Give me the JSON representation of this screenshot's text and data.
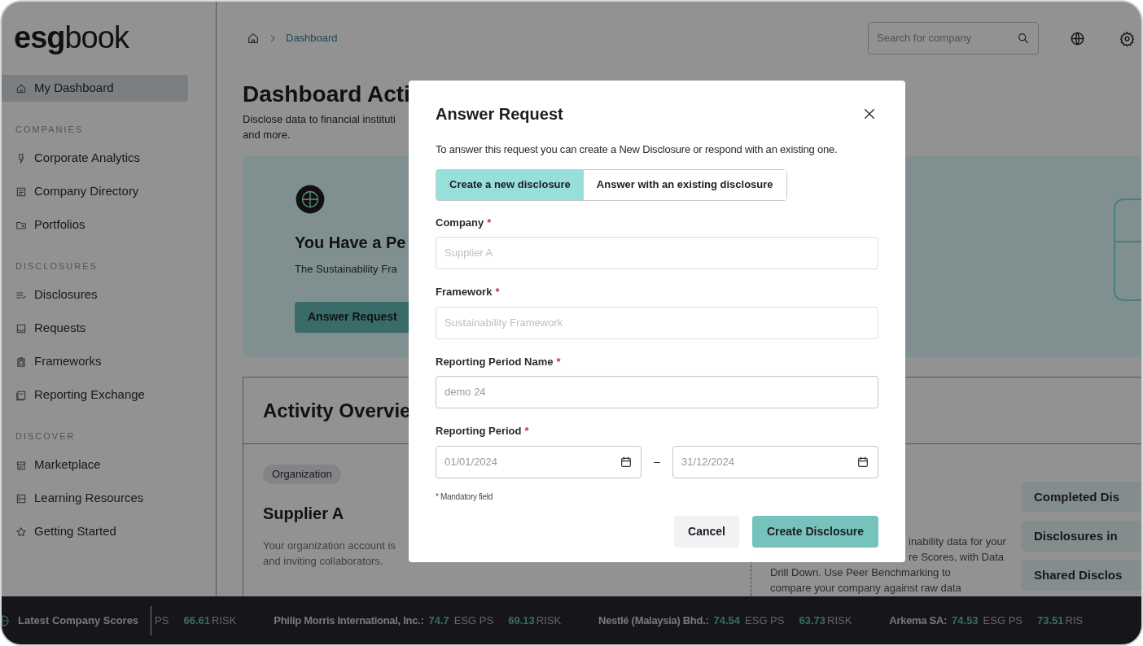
{
  "logo": {
    "bold": "esg",
    "light": "book"
  },
  "sidebar": {
    "sections": [
      {
        "items": [
          {
            "label": "My Dashboard",
            "selected": true
          }
        ]
      },
      {
        "heading": "COMPANIES",
        "items": [
          {
            "label": "Corporate Analytics",
            "selected": false
          },
          {
            "label": "Company Directory",
            "selected": false
          },
          {
            "label": "Portfolios",
            "selected": false
          }
        ]
      },
      {
        "heading": "DISCLOSURES",
        "items": [
          {
            "label": "Disclosures",
            "selected": false
          },
          {
            "label": "Requests",
            "selected": false
          },
          {
            "label": "Frameworks",
            "selected": false
          },
          {
            "label": "Reporting Exchange",
            "selected": false
          }
        ]
      },
      {
        "heading": "DISCOVER",
        "items": [
          {
            "label": "Marketplace",
            "selected": false
          },
          {
            "label": "Learning Resources",
            "selected": false
          },
          {
            "label": "Getting Started",
            "selected": false
          }
        ]
      }
    ]
  },
  "breadcrumb": [
    "Dashboard"
  ],
  "search": {
    "placeholder": "Search for company"
  },
  "page": {
    "title": "Dashboard Acti",
    "description": [
      "Disclose data to financial instituti",
      "and more."
    ]
  },
  "request_card": {
    "title": "You Have a Pe",
    "text": "The Sustainability Fra",
    "button": "Answer Request"
  },
  "activity": {
    "title": "Activity Overvie",
    "tag": "Organization",
    "name": "Supplier A",
    "text": [
      "Your organization account is",
      "and inviting collaborators."
    ],
    "info_text": [
      "inability data for your",
      "re Scores, with Data",
      "Drill Down. Use Peer Benchmarking to",
      "compare your company against raw data"
    ],
    "side_buttons": [
      "Completed Dis",
      "Disclosures in",
      "Shared Disclos"
    ]
  },
  "modal": {
    "title": "Answer Request",
    "intro": "To answer this request you can create a New Disclosure or respond with an existing one.",
    "tabs": [
      {
        "label": "Create a new disclosure",
        "selected": true
      },
      {
        "label": "Answer with an existing disclosure",
        "selected": false
      }
    ],
    "fields": [
      {
        "kind": "text",
        "label": "Company",
        "required_mark": "*",
        "value": "Supplier A",
        "disabled": true
      },
      {
        "kind": "text",
        "label": "Framework",
        "required_mark": "*",
        "value": "Sustainability Framework",
        "disabled": true
      },
      {
        "kind": "text",
        "label": "Reporting Period Name",
        "required_mark": "*",
        "value": "demo 24",
        "disabled": false
      },
      {
        "kind": "date_range",
        "label": "Reporting Period",
        "required_mark": "*",
        "start": "01/01/2024",
        "separator": "–",
        "end": "31/12/2024",
        "disabled": false
      }
    ],
    "note": "* Mandatory field",
    "buttons": [
      {
        "label": "Cancel",
        "kind": "secondary"
      },
      {
        "label": "Create Disclosure",
        "kind": "primary"
      }
    ]
  },
  "ticker": {
    "heading": "Latest Company Scores",
    "items": [
      {
        "esg_label": "PS",
        "risk": "66.61",
        "risk_label": "RISK"
      },
      {
        "company": "Philip Morris International, Inc.:",
        "esg": "74.7",
        "esg_label": "ESG PS",
        "risk": "69.13",
        "risk_label": "RISK"
      },
      {
        "company": "Nestlé (Malaysia) Bhd.:",
        "esg": "74.54",
        "esg_label": "ESG PS",
        "risk": "63.73",
        "risk_label": "RISK"
      },
      {
        "company": "Arkema SA:",
        "esg": "74.53",
        "esg_label": "ESG PS",
        "risk": "73.51",
        "risk_label": "RIS"
      }
    ]
  }
}
